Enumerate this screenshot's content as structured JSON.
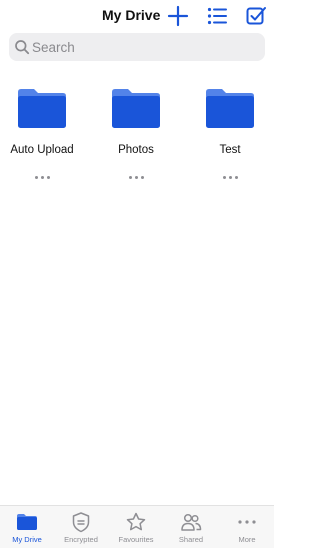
{
  "colors": {
    "accent": "#1a55d9",
    "folder": "#1a55d9",
    "folder_tab": "#5383e9",
    "inactive": "#8e8e93",
    "search_bg": "#eeeef0"
  },
  "header": {
    "title": "My Drive",
    "actions": [
      "plus-icon",
      "list-view-icon",
      "select-checkbox-icon"
    ]
  },
  "search": {
    "placeholder": "Search",
    "value": "",
    "icon": "search-icon"
  },
  "folders": [
    {
      "name": "Auto Upload",
      "icon": "folder-icon"
    },
    {
      "name": "Photos",
      "icon": "folder-icon"
    },
    {
      "name": "Test",
      "icon": "folder-icon"
    }
  ],
  "tabs": [
    {
      "label": "My Drive",
      "icon": "folder-icon",
      "active": true
    },
    {
      "label": "Encrypted",
      "icon": "shield-icon",
      "active": false
    },
    {
      "label": "Favourites",
      "icon": "star-icon",
      "active": false
    },
    {
      "label": "Shared",
      "icon": "people-icon",
      "active": false
    },
    {
      "label": "More",
      "icon": "more-icon",
      "active": false
    }
  ]
}
